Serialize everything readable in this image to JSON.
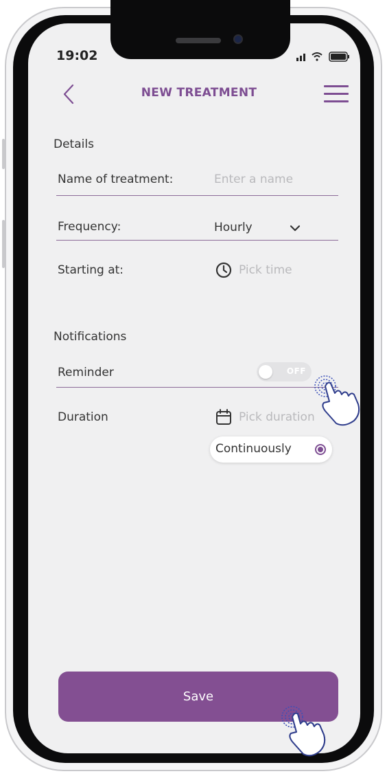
{
  "status_bar": {
    "time": "19:02"
  },
  "header": {
    "title": "NEW TREATMENT"
  },
  "details": {
    "section_title": "Details",
    "name_label": "Name of treatment:",
    "name_placeholder": "Enter a name",
    "frequency_label": "Frequency:",
    "frequency_value": "Hourly",
    "start_label": "Starting at:",
    "start_placeholder": "Pick time"
  },
  "notifications": {
    "section_title": "Notifications",
    "reminder_label": "Reminder",
    "reminder_toggle_text": "OFF",
    "duration_label": "Duration",
    "duration_placeholder": "Pick duration",
    "duration_option": "Continuously"
  },
  "footer": {
    "save_label": "Save"
  },
  "colors": {
    "accent": "#834f92",
    "screen_bg": "#f0f0f1"
  }
}
